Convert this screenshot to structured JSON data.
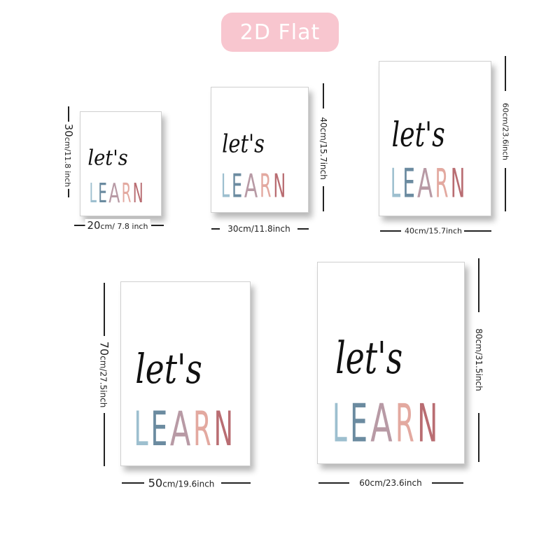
{
  "badge": {
    "label": "2D Flat"
  },
  "poster_text": {
    "line1": "let's",
    "letters": [
      "L",
      "E",
      "A",
      "R",
      "N"
    ]
  },
  "letter_colors": [
    "#9dbfcf",
    "#6b8ba0",
    "#b89aa5",
    "#e3a9a0",
    "#b96d72"
  ],
  "sizes": [
    {
      "h_num": "20",
      "h_rest": "cm/ 7.8 inch",
      "v_num": "30",
      "v_rest": "cm/11.8 inch"
    },
    {
      "h_num": "",
      "h_rest": "30cm/11.8inch",
      "v_num": "",
      "v_rest": "40cm/15.7inch"
    },
    {
      "h_num": "",
      "h_rest": "40cm/15.7inch",
      "v_num": "",
      "v_rest": "60cm/23.6inch"
    },
    {
      "h_num": "50",
      "h_rest": "cm/19.6inch",
      "v_num": "70",
      "v_rest": "cm/27.5inch"
    },
    {
      "h_num": "",
      "h_rest": "60cm/23.6inch",
      "v_num": "",
      "v_rest": "80cm/31.5inch"
    }
  ]
}
